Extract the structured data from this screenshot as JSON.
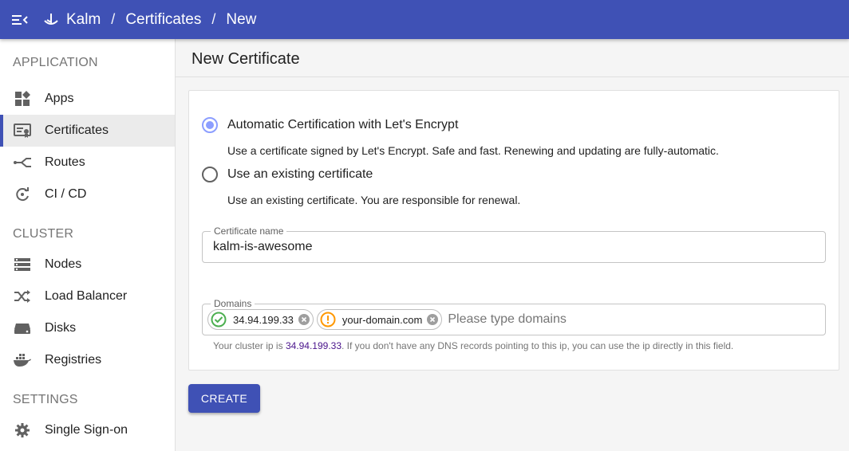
{
  "topbar": {
    "brand": "Kalm",
    "breadcrumb": [
      "Certificates",
      "New"
    ],
    "separator": "/",
    "menu_icon": "menu-open-icon",
    "logo_icon": "kalm-logo-icon"
  },
  "sidebar": {
    "sections": [
      {
        "title": "APPLICATION",
        "items": [
          {
            "label": "Apps",
            "icon": "apps-icon"
          },
          {
            "label": "Certificates",
            "icon": "certificate-icon",
            "active": true
          },
          {
            "label": "Routes",
            "icon": "routes-icon"
          },
          {
            "label": "CI / CD",
            "icon": "ci-cd-icon"
          }
        ]
      },
      {
        "title": "CLUSTER",
        "items": [
          {
            "label": "Nodes",
            "icon": "nodes-icon"
          },
          {
            "label": "Load Balancer",
            "icon": "shuffle-icon"
          },
          {
            "label": "Disks",
            "icon": "disk-icon"
          },
          {
            "label": "Registries",
            "icon": "docker-icon"
          }
        ]
      },
      {
        "title": "SETTINGS",
        "items": [
          {
            "label": "Single Sign-on",
            "icon": "gear-icon"
          }
        ]
      }
    ]
  },
  "page": {
    "title": "New Certificate"
  },
  "form": {
    "options": [
      {
        "label": "Automatic Certification with Let's Encrypt",
        "description": "Use a certificate signed by Let's Encrypt. Safe and fast. Renewing and updating are fully-automatic.",
        "checked": true
      },
      {
        "label": "Use an existing certificate",
        "description": "Use an existing certificate. You are responsible for renewal.",
        "checked": false
      }
    ],
    "cert_name": {
      "label": "Certificate name",
      "value": "kalm-is-awesome"
    },
    "domains": {
      "label": "Domains",
      "chips": [
        {
          "value": "34.94.199.33",
          "status": "ok",
          "status_color": "#4caf50"
        },
        {
          "value": "your-domain.com",
          "status": "warning",
          "status_color": "#ff9800"
        }
      ],
      "placeholder": "Please type domains",
      "helper_prefix": "Your cluster ip is ",
      "helper_ip": "34.94.199.33",
      "helper_suffix": ". If you don't have any DNS records pointing to this ip, you can use the ip directly in this field."
    },
    "submit_label": "CREATE"
  },
  "colors": {
    "primary": "#3f51b5",
    "radio_checked": "#8c9eff",
    "ok": "#4caf50",
    "warning": "#ff9800"
  }
}
